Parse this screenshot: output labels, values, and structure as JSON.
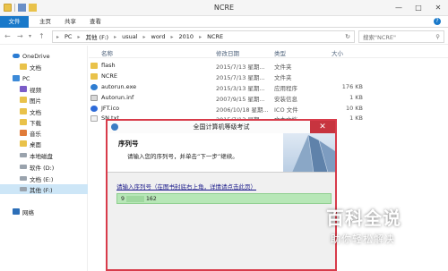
{
  "window": {
    "title": "NCRE"
  },
  "ribbon": {
    "tabs": [
      "文件",
      "主页",
      "共享",
      "查看"
    ]
  },
  "address": {
    "crumbs": [
      "PC",
      "其他 (F:)",
      "usual",
      "word",
      "2010",
      "NCRE"
    ],
    "search_placeholder": "搜索\"NCRE\""
  },
  "nav": {
    "items": [
      {
        "label": "OneDrive",
        "icon": "cloud-icon"
      },
      {
        "label": "文档",
        "icon": "folder-icon"
      },
      {
        "label": "PC",
        "icon": "pc-icon"
      },
      {
        "label": "视频",
        "icon": "video-icon"
      },
      {
        "label": "图片",
        "icon": "folder-icon"
      },
      {
        "label": "文档",
        "icon": "folder-icon"
      },
      {
        "label": "下载",
        "icon": "folder-icon"
      },
      {
        "label": "音乐",
        "icon": "music-icon"
      },
      {
        "label": "桌面",
        "icon": "folder-icon"
      },
      {
        "label": "本地磁盘",
        "icon": "drive-icon"
      },
      {
        "label": "软件 (D:)",
        "icon": "drive-icon"
      },
      {
        "label": "文档 (E:)",
        "icon": "drive-icon"
      },
      {
        "label": "其他 (F:)",
        "icon": "drive-icon"
      },
      {
        "label": "网络",
        "icon": "network-icon"
      }
    ],
    "selected_index": 12
  },
  "list": {
    "columns": {
      "name": "名称",
      "date": "修改日期",
      "type": "类型",
      "size": "大小"
    },
    "rows": [
      {
        "name": "flash",
        "date": "2015/7/13 星期...",
        "type": "文件夹",
        "size": "",
        "icon": "folder-icon"
      },
      {
        "name": "NCRE",
        "date": "2015/7/13 星期...",
        "type": "文件夹",
        "size": "",
        "icon": "folder-icon"
      },
      {
        "name": "autorun.exe",
        "date": "2015/3/13 星期...",
        "type": "应用程序",
        "size": "176 KB",
        "icon": "exe-icon"
      },
      {
        "name": "Autorun.inf",
        "date": "2007/9/15 星期...",
        "type": "安装信息",
        "size": "1 KB",
        "icon": "inf-icon"
      },
      {
        "name": "JFT.ico",
        "date": "2006/10/18 星期...",
        "type": "ICO 文件",
        "size": "10 KB",
        "icon": "ico-icon"
      },
      {
        "name": "SN.txt",
        "date": "2015/7/13 星期...",
        "type": "文本文档",
        "size": "1 KB",
        "icon": "text-file-icon"
      }
    ]
  },
  "dialog": {
    "title": "全国计算机等级考试",
    "heading": "序列号",
    "subtitle": "请输入您的序列号，并单击“下一步”继续。",
    "prompt": "请输入序列号（在图书封底右上角，详情请点击此页）",
    "serial_prefix": "9",
    "serial_suffix": "162"
  },
  "watermark": {
    "main": "百科全说",
    "sub": "助你轻松解决"
  }
}
